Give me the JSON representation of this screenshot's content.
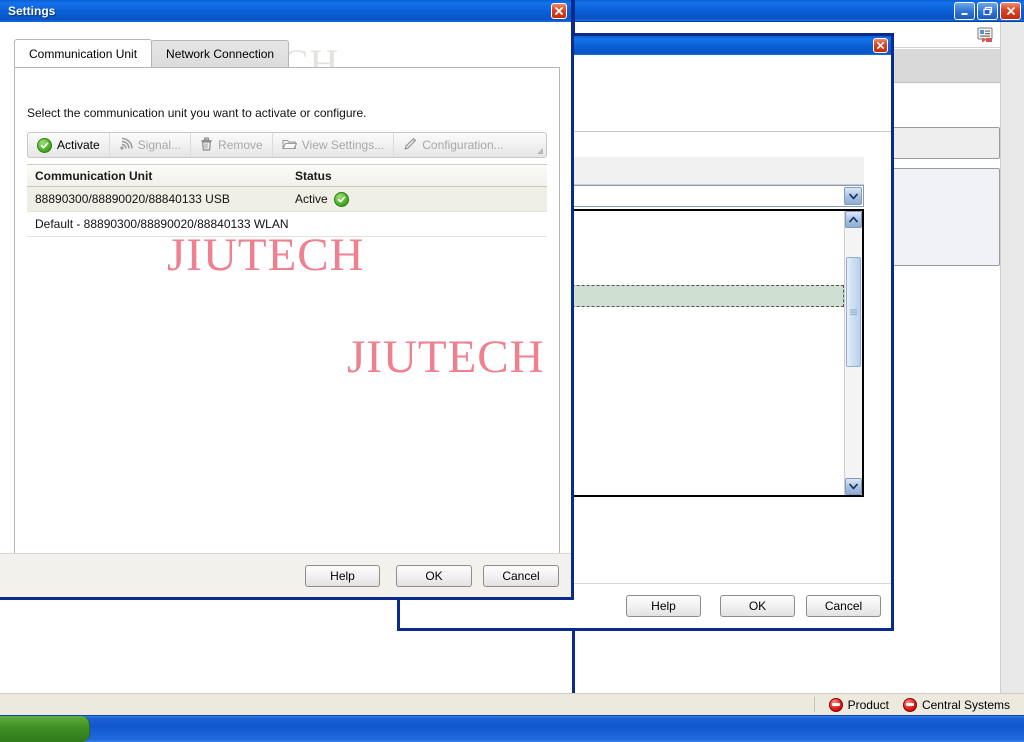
{
  "app_window": {
    "minimize_label": "Minimize",
    "maximize_label": "Restore",
    "close_label": "Close",
    "toolbar_icon": "card-send-icon"
  },
  "background_dialog": {
    "close_label": "Close",
    "buttons": {
      "help": "Help",
      "ok": "OK",
      "cancel": "Cancel"
    },
    "scroll": {
      "up": "scroll-up",
      "down": "scroll-down"
    }
  },
  "settings_dialog": {
    "title": "Settings",
    "close_label": "Close",
    "tabs": [
      {
        "label": "Communication Unit",
        "active": true
      },
      {
        "label": "Network Connection",
        "active": false
      }
    ],
    "description": "Select the communication unit you want to activate or configure.",
    "toolbar": [
      {
        "label": "Activate",
        "icon": "green-check-icon",
        "disabled": false
      },
      {
        "label": "Signal...",
        "icon": "signal-icon",
        "disabled": true
      },
      {
        "label": "Remove",
        "icon": "trash-icon",
        "disabled": true
      },
      {
        "label": "View Settings...",
        "icon": "folder-icon",
        "disabled": true
      },
      {
        "label": "Configuration...",
        "icon": "pencil-icon",
        "disabled": true
      }
    ],
    "table": {
      "columns": [
        "Communication Unit",
        "Status"
      ],
      "rows": [
        {
          "name": "88890300/88890020/88840133 USB",
          "status": "Active",
          "status_icon": "green-check-icon",
          "selected": true
        },
        {
          "name": "Default - 88890300/88890020/88840133 WLAN",
          "status": "",
          "status_icon": "",
          "selected": false
        }
      ]
    },
    "buttons": {
      "help": "Help",
      "ok": "OK",
      "cancel": "Cancel"
    }
  },
  "statusbar": {
    "items": [
      {
        "label": "Product",
        "icon": "red-block-icon"
      },
      {
        "label": "Central Systems",
        "icon": "red-block-icon"
      }
    ]
  },
  "taskbar": {
    "start_label": ""
  },
  "watermarks": {
    "main": "JIUTECH",
    "secondary": "JIUTECH",
    "faint_top": "JIUTECH",
    "faint_header": "JIUTECH"
  },
  "colors": {
    "titlebar_blue": "#0a60d8",
    "dialog_border": "#0a2a8c",
    "watermark_pink": "#ef8090",
    "selected_row": "#efefe5",
    "status_green": "#4cb429",
    "status_red": "#e02020",
    "list_selection_green": "#cfdfd0"
  }
}
